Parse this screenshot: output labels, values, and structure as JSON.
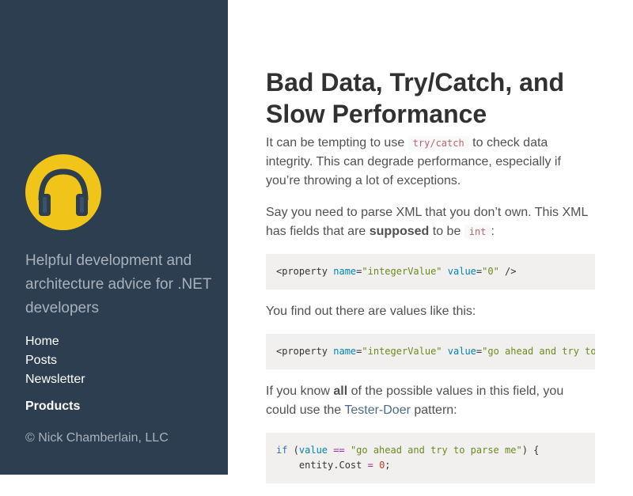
{
  "sidebar": {
    "tagline": "Helpful development and architecture advice for .NET developers",
    "nav": [
      {
        "label": "Home"
      },
      {
        "label": "Posts"
      },
      {
        "label": "Newsletter"
      }
    ],
    "products_label": "Products",
    "copyright": "© Nick Chamberlain, LLC",
    "logo_icon": "headphones-icon",
    "logo_color": "#f0c419",
    "background_color": "#2c3e50"
  },
  "article": {
    "title": "Bad Data, Try/Catch, and Slow Performance",
    "p1": {
      "before": "It can be tempting to use ",
      "code": "try/catch",
      "after": " to check data integrity. This can degrade performance, especially if you’re throwing a lot of exceptions."
    },
    "p2": {
      "before": "Say you need to parse XML that you don’t own. This XML has fields that are ",
      "bold": "supposed",
      "middle": " to be ",
      "code": "int",
      "after": ":"
    },
    "code1": {
      "tag_open": "<property ",
      "attr1": "name",
      "eq1": "=",
      "val1": "\"integerValue\"",
      "sp": " ",
      "attr2": "value",
      "eq2": "=",
      "val2": "\"0\"",
      "tag_close": " />"
    },
    "p3": "You find out there are values like this:",
    "code2": {
      "tag_open": "<property ",
      "attr1": "name",
      "eq1": "=",
      "val1": "\"integerValue\"",
      "sp": " ",
      "attr2": "value",
      "eq2": "=",
      "val2": "\"go ahead and try to parse me\" />"
    },
    "p4": {
      "before": "If you know ",
      "bold": "all",
      "middle": " of the possible values in this field, you could use the ",
      "link": "Tester-Doer",
      "after": " pattern:"
    },
    "code3": {
      "line1_kw": "if",
      "line1_open": " (",
      "line1_var": "value",
      "line1_op": " == ",
      "line1_str": "\"go ahead and try to parse me\"",
      "line1_close": ") {",
      "line2_indent": "    entity.Cost ",
      "line2_op": "=",
      "line2_sp": " ",
      "line2_num": "0",
      "line2_end": ";"
    }
  }
}
